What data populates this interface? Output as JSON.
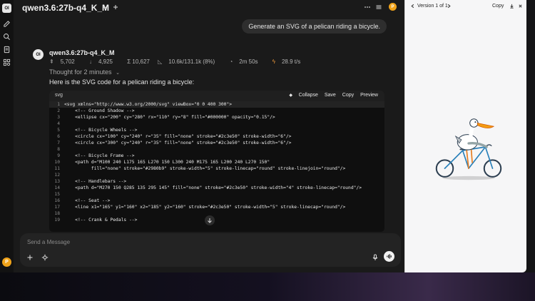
{
  "sidebar": {
    "logo": "OI",
    "user_initial": "P"
  },
  "header": {
    "model_name": "qwen3.6:27b-q4_K_M"
  },
  "chat": {
    "user_message": "Generate an SVG of a pelican riding a bicycle.",
    "assistant": {
      "avatar": "OI",
      "name": "qwen3.6:27b-q4_K_M",
      "stats": {
        "stat1": "5,702",
        "stat2": "4,925",
        "stat3": "Σ 10,627",
        "context": "10.6k/131.1k (8%)",
        "time": "2m 50s",
        "speed": "28.9 t/s"
      },
      "thought": "Thought for 2 minutes",
      "intro": "Here is the SVG code for a pelican riding a bicycle:",
      "code": {
        "language": "svg",
        "actions": {
          "collapse": "Collapse",
          "save": "Save",
          "copy": "Copy",
          "preview": "Preview"
        },
        "lines": [
          {
            "n": "1",
            "t": "<svg xmlns=\"http://www.w3.org/2000/svg\" viewBox=\"0 0 400 300\">"
          },
          {
            "n": "2",
            "t": "    <!-- Ground Shadow -->"
          },
          {
            "n": "3",
            "t": "    <ellipse cx=\"200\" cy=\"280\" rx=\"110\" ry=\"8\" fill=\"#000000\" opacity=\"0.15\"/>"
          },
          {
            "n": "4",
            "t": ""
          },
          {
            "n": "5",
            "t": "    <!-- Bicycle Wheels -->"
          },
          {
            "n": "6",
            "t": "    <circle cx=\"100\" cy=\"240\" r=\"35\" fill=\"none\" stroke=\"#2c3e50\" stroke-width=\"6\"/>"
          },
          {
            "n": "7",
            "t": "    <circle cx=\"300\" cy=\"240\" r=\"35\" fill=\"none\" stroke=\"#2c3e50\" stroke-width=\"6\"/>"
          },
          {
            "n": "8",
            "t": ""
          },
          {
            "n": "9",
            "t": "    <!-- Bicycle Frame -->"
          },
          {
            "n": "10",
            "t": "    <path d=\"M100 240 L175 165 L270 150 L300 240 M175 165 L200 240 L270 150\""
          },
          {
            "n": "11",
            "t": "          fill=\"none\" stroke=\"#2980b9\" stroke-width=\"5\" stroke-linecap=\"round\" stroke-linejoin=\"round\"/>"
          },
          {
            "n": "12",
            "t": ""
          },
          {
            "n": "13",
            "t": "    <!-- Handlebars -->"
          },
          {
            "n": "14",
            "t": "    <path d=\"M270 150 Q285 135 295 145\" fill=\"none\" stroke=\"#2c3e50\" stroke-width=\"4\" stroke-linecap=\"round\"/>"
          },
          {
            "n": "15",
            "t": ""
          },
          {
            "n": "16",
            "t": "    <!-- Seat -->"
          },
          {
            "n": "17",
            "t": "    <line x1=\"165\" y1=\"160\" x2=\"185\" y2=\"160\" stroke=\"#2c3e50\" stroke-width=\"5\" stroke-linecap=\"round\"/>"
          },
          {
            "n": "18",
            "t": ""
          },
          {
            "n": "19",
            "t": "    <!-- Crank & Pedals -->"
          }
        ]
      }
    },
    "input": {
      "placeholder": "Send a Message"
    }
  },
  "artifact": {
    "version": "Version 1 of 1",
    "copy": "Copy"
  },
  "colors": {
    "wheel": "#2c3e50",
    "frame": "#2980b9",
    "beak": "#f39c12",
    "avatar": "#f0a31a"
  }
}
